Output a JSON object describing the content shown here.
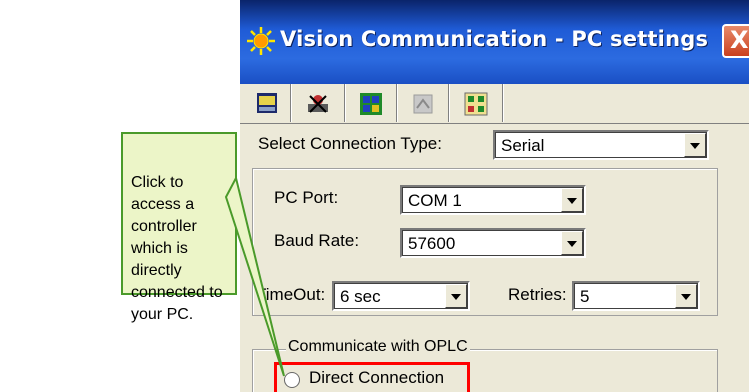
{
  "window": {
    "title": "Vision Communication - PC settings",
    "close_label": "X"
  },
  "tabs": [
    {
      "icon": "pc-settings-icon",
      "active": true
    },
    {
      "icon": "network-icon",
      "active": false
    },
    {
      "icon": "ethernet-icon",
      "active": false
    },
    {
      "icon": "gsm-modem-icon",
      "active": false
    },
    {
      "icon": "modem-settings-icon",
      "active": false
    }
  ],
  "connection": {
    "label": "Select Connection Type:",
    "value": "Serial"
  },
  "serial": {
    "pc_port_label": "PC Port:",
    "pc_port_value": "COM 1",
    "baud_rate_label": "Baud Rate:",
    "baud_rate_value": "57600",
    "timeout_label": "TimeOut:",
    "timeout_value": "6 sec",
    "retries_label": "Retries:",
    "retries_value": "5"
  },
  "communicate": {
    "legend": "Communicate with OPLC",
    "direct_connection_label": "Direct Connection"
  },
  "callout": {
    "text": "Click to access a controller which is directly connected to your PC."
  },
  "colors": {
    "title_bar": "#2c6be0",
    "callout_bg": "#ecf5c8",
    "callout_border": "#4a9a2a",
    "highlight": "#ff0000"
  }
}
